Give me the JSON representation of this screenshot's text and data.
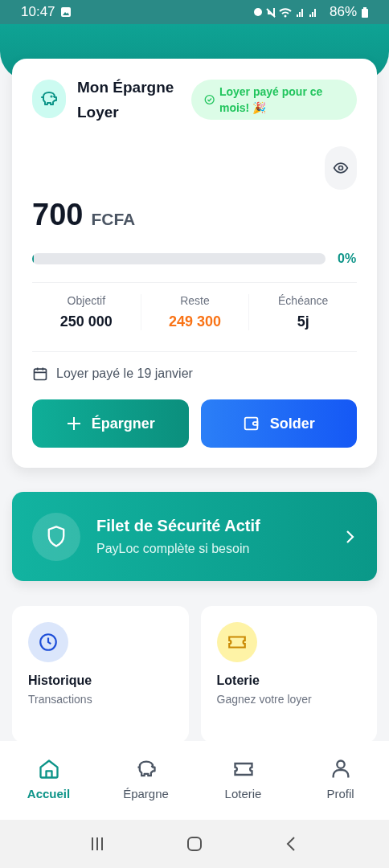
{
  "status_bar": {
    "time": "10:47",
    "battery": "86%"
  },
  "savings_card": {
    "title": "Mon Épargne Loyer",
    "badge": "Loyer payé pour ce mois! 🎉",
    "amount": "700",
    "currency": "FCFA",
    "progress": {
      "level": 0.005,
      "reading": "0%"
    },
    "stats": [
      {
        "label": "Objectif",
        "value": "250 000",
        "kind": "normal"
      },
      {
        "label": "Reste",
        "value": "249 300",
        "kind": "warning"
      },
      {
        "label": "Échéance",
        "value": "5j",
        "kind": "normal"
      }
    ],
    "payment_note": "Loyer payé le 19 janvier",
    "buttons": [
      {
        "label": "Épargner",
        "kind": "save"
      },
      {
        "label": "Solder",
        "kind": "settle"
      }
    ]
  },
  "safety_banner": {
    "title": "Filet de Sécurité Actif",
    "subtitle": "PayLoc complète si besoin"
  },
  "tiles": [
    {
      "title": "Historique",
      "subtitle": "Transactions",
      "kind": "history"
    },
    {
      "title": "Loterie",
      "subtitle": "Gagnez votre loyer",
      "kind": "lottery"
    }
  ],
  "bottom_nav": [
    {
      "label": "Accueil",
      "kind": "home",
      "selected": true
    },
    {
      "label": "Épargne",
      "kind": "savings",
      "selected": false
    },
    {
      "label": "Loterie",
      "kind": "lottery",
      "selected": false
    },
    {
      "label": "Profil",
      "kind": "profile",
      "selected": false
    }
  ]
}
